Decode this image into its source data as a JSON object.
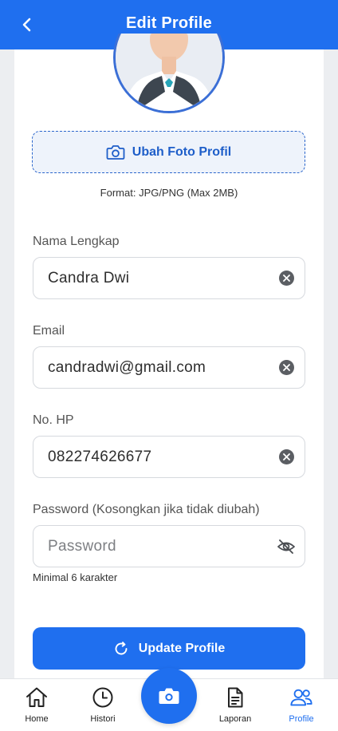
{
  "header": {
    "title": "Edit Profile",
    "back_icon": "chevron-left-icon"
  },
  "photo": {
    "change_label": "Ubah Foto Profil",
    "format_note": "Format: JPG/PNG (Max 2MB)"
  },
  "form": {
    "name": {
      "label": "Nama Lengkap",
      "value": "Candra Dwi"
    },
    "email": {
      "label": "Email",
      "value": "candradwi@gmail.com"
    },
    "phone": {
      "label": "No. HP",
      "value": "082274626677"
    },
    "password": {
      "label": "Password (Kosongkan jika tidak diubah)",
      "placeholder": "Password",
      "hint": "Minimal 6 karakter"
    },
    "submit_label": "Update Profile"
  },
  "nav": {
    "items": [
      {
        "label": "Home",
        "icon": "home-icon"
      },
      {
        "label": "Histori",
        "icon": "clock-icon"
      },
      {
        "label": "Laporan",
        "icon": "document-icon"
      },
      {
        "label": "Profile",
        "icon": "users-icon"
      }
    ],
    "active": "Profile",
    "fab_icon": "camera-icon"
  },
  "colors": {
    "primary": "#1f6fef",
    "background": "#eceef1",
    "accent_dashed": "#2b66cc"
  }
}
